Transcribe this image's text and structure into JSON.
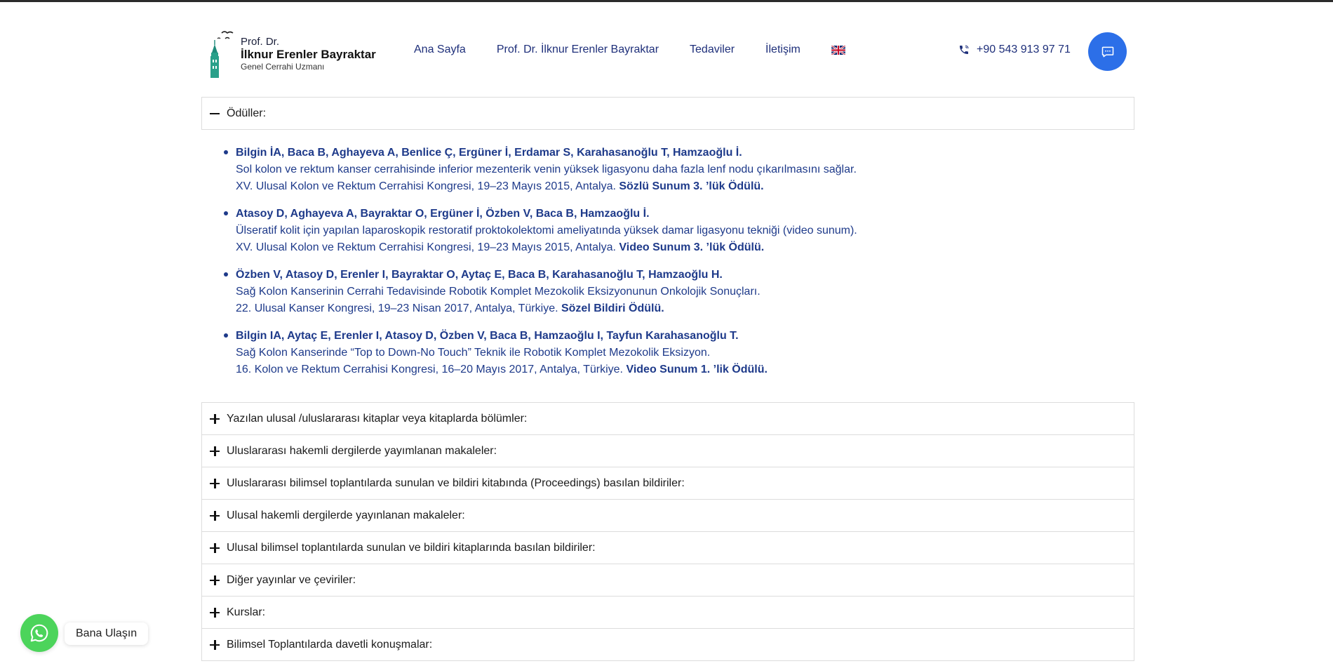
{
  "header": {
    "logo": {
      "line1": "Prof. Dr.",
      "line2": "İlknur Erenler Bayraktar",
      "line3": "Genel Cerrahi Uzmanı",
      "icon": "galata-tower-logo"
    },
    "nav": [
      {
        "label": "Ana Sayfa"
      },
      {
        "label": "Prof. Dr. İlknur Erenler Bayraktar"
      },
      {
        "label": "Tedaviler"
      },
      {
        "label": "İletişim"
      }
    ],
    "language_icon": "uk-flag-icon",
    "phone": "+90 543 913 97 71",
    "chat_icon": "chat-bubble-icon"
  },
  "accordion": {
    "open_section": {
      "title": "Ödüller:",
      "icon": "minus-icon"
    },
    "awards": [
      {
        "authors": "Bilgin İA, Baca B, Aghayeva A, Benlice Ç, Ergüner İ, Erdamar S, Karahasanoğlu T, Hamzaoğlu İ.",
        "title": "Sol kolon ve rektum kanser cerrahisinde inferior mezenterik venin yüksek ligasyonu daha fazla lenf nodu çıkarılmasını sağlar.",
        "venue": "XV. Ulusal Kolon ve Rektum Cerrahisi Kongresi, 19–23 Mayıs 2015, Antalya.",
        "award": "Sözlü Sunum 3. ’lük Ödülü."
      },
      {
        "authors": "Atasoy D, Aghayeva A, Bayraktar O, Ergüner İ, Özben V, Baca B, Hamzaoğlu İ.",
        "title": "Ülseratif kolit için yapılan laparoskopik restoratif proktokolektomi ameliyatında yüksek damar ligasyonu tekniği (video sunum).",
        "venue": "XV. Ulusal Kolon ve Rektum Cerrahisi Kongresi, 19–23 Mayıs 2015, Antalya.",
        "award": "Video Sunum 3. ’lük Ödülü."
      },
      {
        "authors": "Özben V, Atasoy D, Erenler I, Bayraktar O, Aytaç E, Baca B, Karahasanoğlu T, Hamzaoğlu H.",
        "title": "Sağ Kolon Kanserinin Cerrahi Tedavisinde Robotik Komplet Mezokolik Eksizyonunun Onkolojik Sonuçları.",
        "venue": "22. Ulusal Kanser Kongresi, 19–23 Nisan 2017, Antalya, Türkiye.",
        "award": "Sözel Bildiri Ödülü."
      },
      {
        "authors": "Bilgin IA, Aytaç E, Erenler I, Atasoy D, Özben V, Baca B, Hamzaoğlu I, Tayfun Karahasanoğlu T.",
        "title": "Sağ Kolon Kanserinde “Top to Down-No Touch” Teknik ile Robotik Komplet Mezokolik Eksizyon.",
        "venue": "16. Kolon ve Rektum Cerrahisi Kongresi, 16–20 Mayıs 2017, Antalya, Türkiye.",
        "award": "Video Sunum 1. ’lik Ödülü."
      }
    ],
    "collapsed_sections": [
      {
        "title": "Yazılan ulusal /uluslararası kitaplar veya kitaplarda bölümler:"
      },
      {
        "title": "Uluslararası hakemli dergilerde yayımlanan makaleler:"
      },
      {
        "title": "Uluslararası bilimsel toplantılarda sunulan ve bildiri kitabında (Proceedings) basılan bildiriler:"
      },
      {
        "title": "Ulusal hakemli dergilerde yayınlanan makaleler:"
      },
      {
        "title": "Ulusal bilimsel toplantılarda sunulan ve bildiri kitaplarında basılan bildiriler:"
      },
      {
        "title": "Diğer yayınlar ve çeviriler:"
      },
      {
        "title": "Kurslar:"
      },
      {
        "title": "Bilimsel Toplantılarda davetli konuşmalar:"
      }
    ],
    "collapsed_icon": "plus-icon"
  },
  "whatsapp": {
    "label": "Bana Ulaşın",
    "icon": "whatsapp-icon",
    "color": "#4cd45b"
  },
  "colors": {
    "accent": "#2c6fe8",
    "text_primary": "#1e3a8a",
    "logo_teal": "#2aa08a"
  }
}
